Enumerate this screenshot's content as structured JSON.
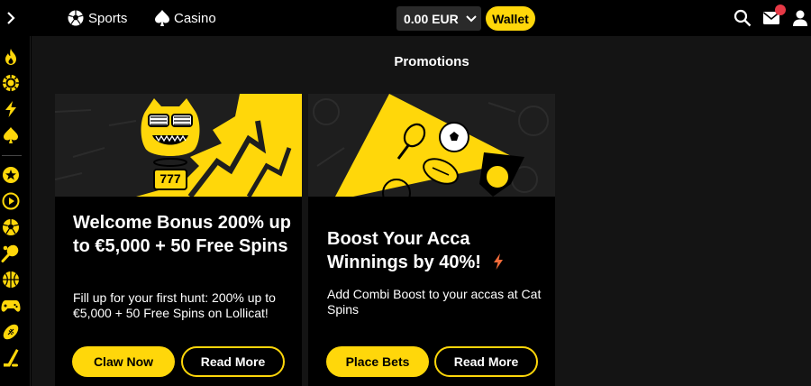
{
  "header": {
    "nav": [
      {
        "label": "Sports",
        "icon": "soccer-ball-icon"
      },
      {
        "label": "Casino",
        "icon": "spade-icon"
      }
    ],
    "balance": "0.00 EUR",
    "wallet_label": "Wallet",
    "icons": [
      "search-icon",
      "mail-icon",
      "user-icon"
    ],
    "accent": "#ffd70a",
    "notification_color": "#e63946"
  },
  "sidebar": {
    "icons": [
      "fire-icon",
      "casino-chip-icon",
      "lightning-icon",
      "spade-icon",
      "star-icon",
      "play-icon",
      "soccer-icon",
      "tennis-icon",
      "basketball-icon",
      "esports-controller-icon",
      "american-football-icon",
      "hockey-icon"
    ]
  },
  "main": {
    "title": "Promotions",
    "cards": [
      {
        "title": "Welcome Bonus 200% up to €5,000 + 50 Free Spins",
        "description": "Fill up for your first hunt: 200% up to €5,000 + 50 Free Spins on Lollicat!",
        "primary_button": "Claw Now",
        "secondary_button": "Read More",
        "banner_badge": "777"
      },
      {
        "title": "Boost Your Acca Winnings by 40%!",
        "description": "Add Combi Boost to your accas at Cat Spins",
        "primary_button": "Place Bets",
        "secondary_button": "Read More"
      }
    ]
  }
}
